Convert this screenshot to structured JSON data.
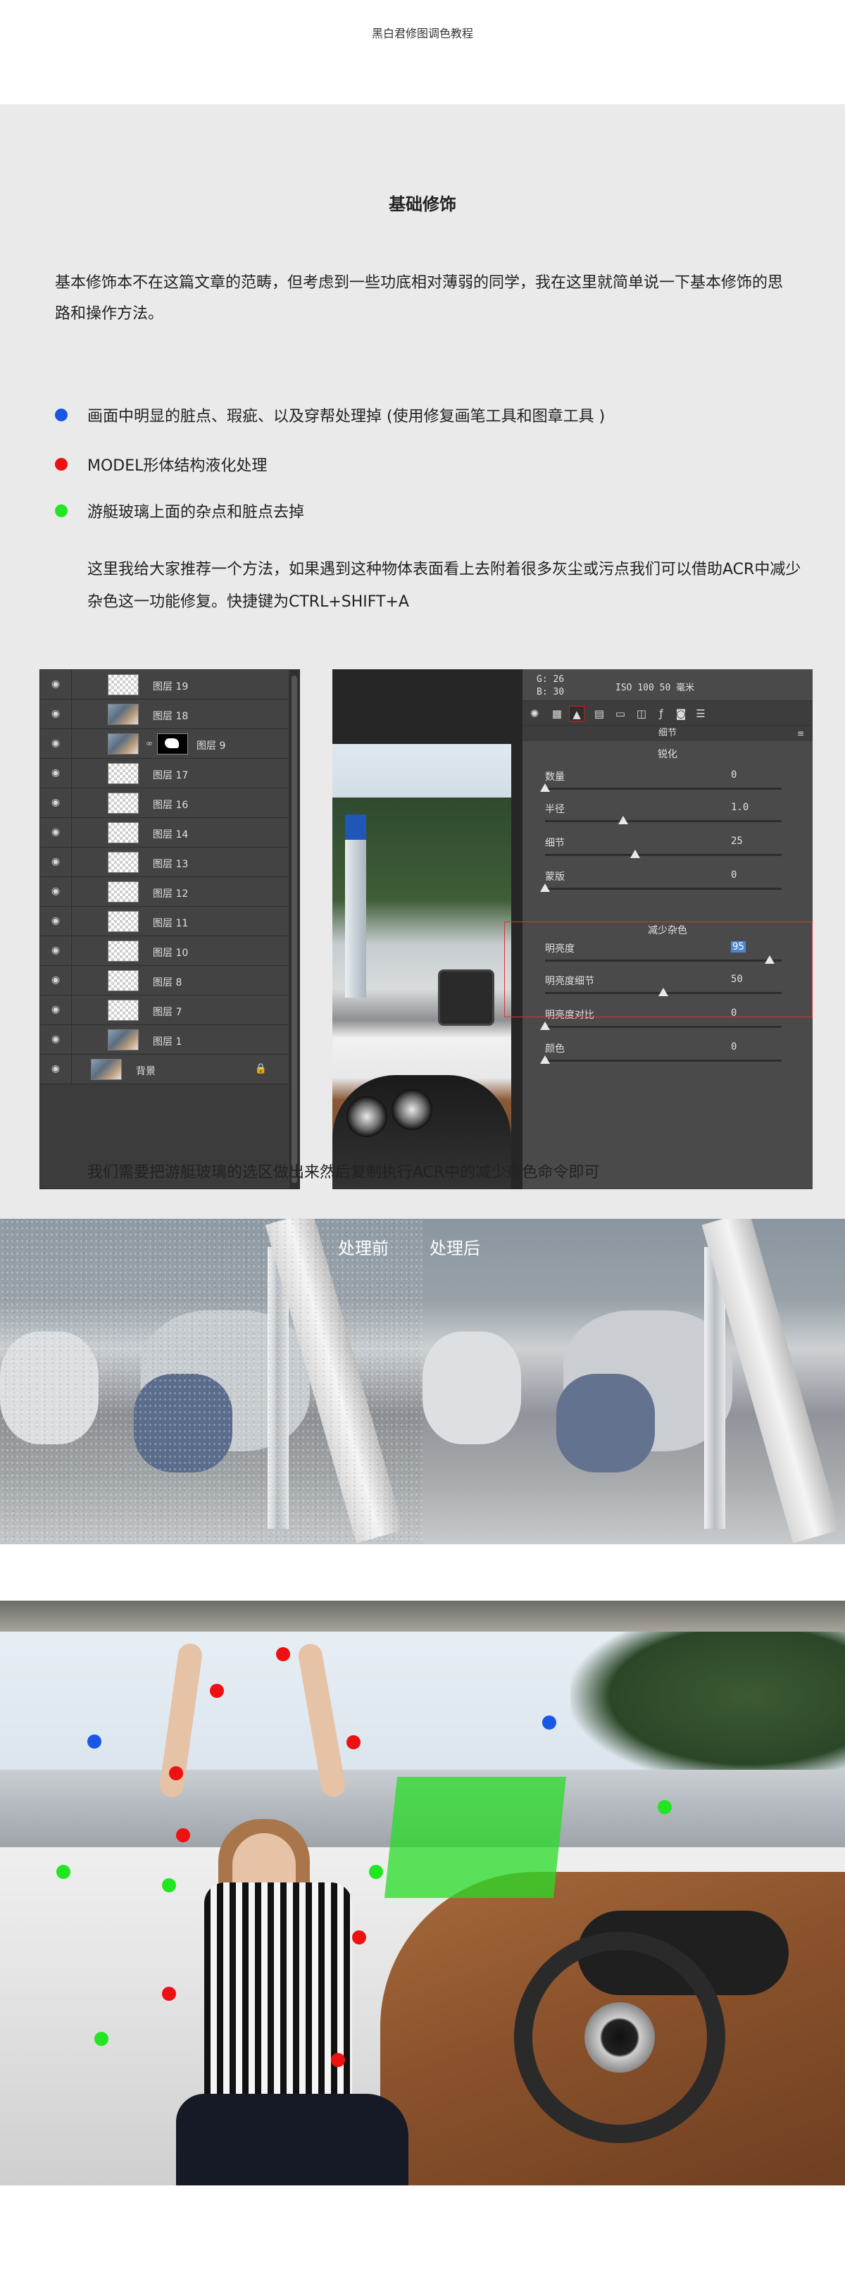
{
  "header": {
    "title": "黑白君修图调色教程"
  },
  "section": {
    "title": "基础修饰",
    "intro": "基本修饰本不在这篇文章的范畴，但考虑到一些功底相对薄弱的同学，我在这里就简单说一下基本修饰的思路和操作方法。",
    "bullets": [
      {
        "text": "画面中明显的脏点、瑕疵、以及穿帮处理掉 (使用修复画笔工具和图章工具 )",
        "color": "#1a56e6"
      },
      {
        "text": "MODEL形体结构液化处理",
        "color": "#ee1111"
      },
      {
        "text": "游艇玻璃上面的杂点和脏点去掉",
        "color": "#22e622"
      }
    ],
    "tip": "这里我给大家推荐一个方法，如果遇到这种物体表面看上去附着很多灰尘或污点我们可以借助ACR中减少杂色这一功能修复。快捷键为CTRL+SHIFT+A",
    "caption": "我们需要把游艇玻璃的选区做出来然后复制执行ACR中的减少杂色命令即可"
  },
  "layers_panel": {
    "rows": [
      {
        "name": "图层 19",
        "thumb": "transparent"
      },
      {
        "name": "图层 18",
        "thumb": "photo"
      },
      {
        "name": "图层 9",
        "thumb": "photo",
        "mask": true
      },
      {
        "name": "图层 17",
        "thumb": "transparent"
      },
      {
        "name": "图层 16",
        "thumb": "transparent"
      },
      {
        "name": "图层 14",
        "thumb": "transparent"
      },
      {
        "name": "图层 13",
        "thumb": "transparent"
      },
      {
        "name": "图层 12",
        "thumb": "transparent"
      },
      {
        "name": "图层 11",
        "thumb": "transparent"
      },
      {
        "name": "图层 10",
        "thumb": "transparent"
      },
      {
        "name": "图层 8",
        "thumb": "transparent"
      },
      {
        "name": "图层 7",
        "thumb": "transparent"
      },
      {
        "name": "图层 1",
        "thumb": "photo"
      },
      {
        "name": "背景",
        "thumb": "photo",
        "locked": true
      }
    ]
  },
  "acr": {
    "readout_g": "G:  26",
    "readout_b": "B:  30",
    "camera_info": "ISO 100   50 毫米",
    "tab_title": "细节",
    "sharpen_title": "锐化",
    "noise_title": "减少杂色",
    "sharpen": [
      {
        "label": "数量",
        "value": "0",
        "level": 0.0
      },
      {
        "label": "半径",
        "value": "1.0",
        "level": 0.33
      },
      {
        "label": "细节",
        "value": "25",
        "level": 0.38
      },
      {
        "label": "蒙版",
        "value": "0",
        "level": 0.0
      }
    ],
    "noise": [
      {
        "label": "明亮度",
        "value": "95",
        "level": 0.95,
        "highlight": true
      },
      {
        "label": "明亮度细节",
        "value": "50",
        "level": 0.5
      },
      {
        "label": "明亮度对比",
        "value": "0",
        "level": 0.0
      },
      {
        "label": "颜色",
        "value": "0",
        "level": 0.0
      }
    ]
  },
  "compare": {
    "before_label": "处理前",
    "after_label": "处理后"
  },
  "markers": {
    "colors": {
      "blue": "#1a56e6",
      "red": "#ee1111",
      "green": "#22e622"
    }
  }
}
